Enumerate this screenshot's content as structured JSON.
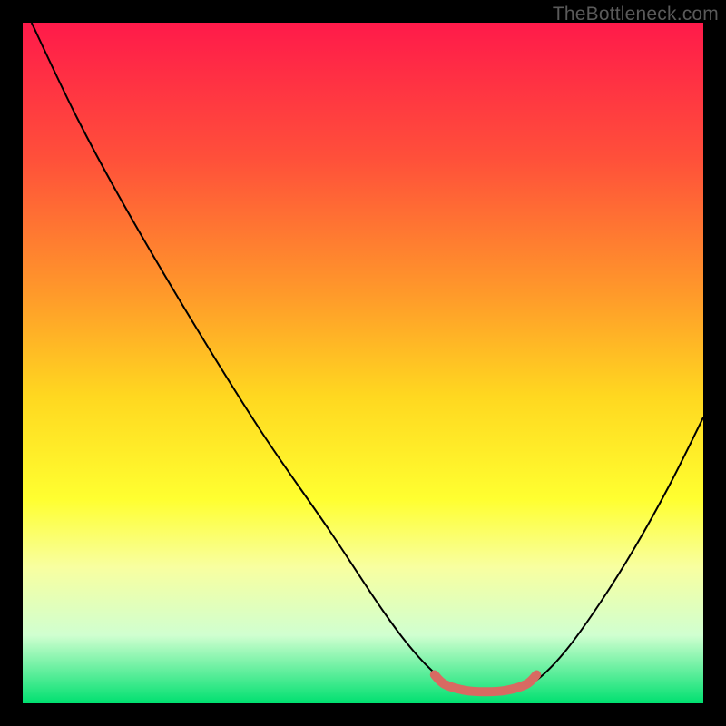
{
  "watermark": "TheBottleneck.com",
  "chart_data": {
    "type": "line",
    "title": "",
    "xlabel": "",
    "ylabel": "",
    "xlim": [
      0,
      100
    ],
    "ylim": [
      0,
      100
    ],
    "gradient_stops": [
      {
        "offset": 0,
        "color": "#ff1a4a"
      },
      {
        "offset": 20,
        "color": "#ff503a"
      },
      {
        "offset": 40,
        "color": "#ff9a2a"
      },
      {
        "offset": 55,
        "color": "#ffd820"
      },
      {
        "offset": 70,
        "color": "#ffff30"
      },
      {
        "offset": 80,
        "color": "#f8ffa0"
      },
      {
        "offset": 90,
        "color": "#d0ffd0"
      },
      {
        "offset": 100,
        "color": "#00e070"
      }
    ],
    "series": [
      {
        "name": "bottleneck-curve",
        "color": "#000000",
        "points": [
          {
            "x": 1.3,
            "y": 100.0
          },
          {
            "x": 8.0,
            "y": 86.0
          },
          {
            "x": 15.0,
            "y": 73.0
          },
          {
            "x": 25.0,
            "y": 56.0
          },
          {
            "x": 35.0,
            "y": 40.0
          },
          {
            "x": 45.0,
            "y": 25.5
          },
          {
            "x": 53.0,
            "y": 13.5
          },
          {
            "x": 58.0,
            "y": 7.0
          },
          {
            "x": 62.0,
            "y": 3.2
          },
          {
            "x": 64.0,
            "y": 2.1
          },
          {
            "x": 67.0,
            "y": 1.7
          },
          {
            "x": 70.0,
            "y": 1.7
          },
          {
            "x": 73.0,
            "y": 2.2
          },
          {
            "x": 76.0,
            "y": 3.8
          },
          {
            "x": 80.0,
            "y": 8.0
          },
          {
            "x": 85.0,
            "y": 15.0
          },
          {
            "x": 90.0,
            "y": 23.0
          },
          {
            "x": 95.0,
            "y": 32.0
          },
          {
            "x": 100.0,
            "y": 42.0
          }
        ]
      },
      {
        "name": "optimal-zone-marker",
        "color": "#d86a62",
        "points": [
          {
            "x": 60.5,
            "y": 4.2
          },
          {
            "x": 62.0,
            "y": 2.8
          },
          {
            "x": 65.0,
            "y": 1.9
          },
          {
            "x": 68.0,
            "y": 1.7
          },
          {
            "x": 71.0,
            "y": 1.9
          },
          {
            "x": 74.0,
            "y": 2.8
          },
          {
            "x": 75.5,
            "y": 4.2
          }
        ]
      }
    ]
  }
}
